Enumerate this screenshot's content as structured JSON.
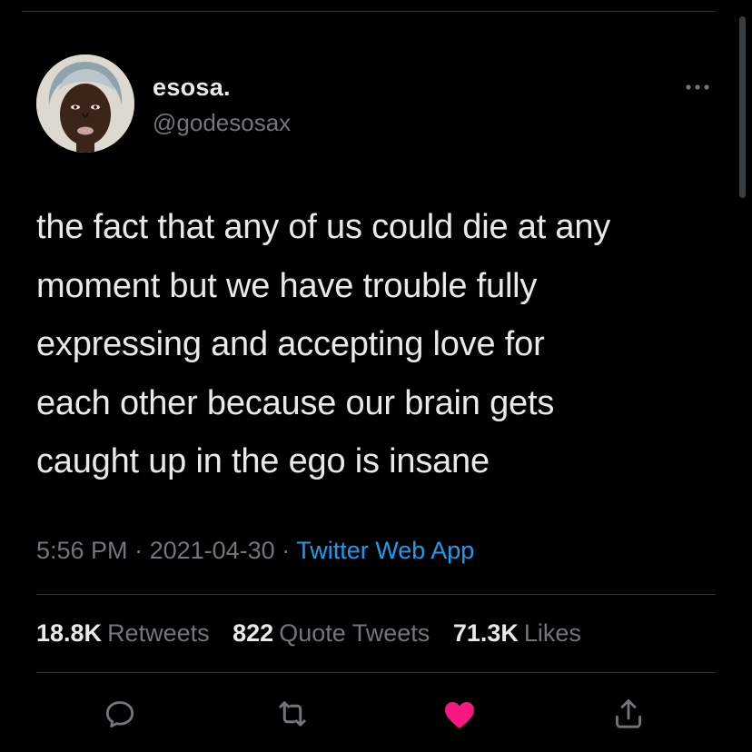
{
  "author": {
    "display_name": "esosa.",
    "handle": "@godesosax",
    "avatar_icon": "profile-photo"
  },
  "menu_icon": "more-dots-icon",
  "tweet": {
    "lines": [
      "the fact that any of us could die at any",
      "moment but we have trouble fully",
      "expressing and accepting love for",
      "each other because our brain gets",
      "caught up in the ego is insane"
    ]
  },
  "meta": {
    "time": "5:56 PM",
    "separator": " · ",
    "date": "2021-04-30",
    "source": "Twitter Web App"
  },
  "stats": {
    "retweets_count": "18.8K",
    "retweets_label": "Retweets",
    "quotes_count": "822",
    "quotes_label": "Quote Tweets",
    "likes_count": "71.3K",
    "likes_label": "Likes"
  },
  "actions": [
    {
      "icon": "reply-icon"
    },
    {
      "icon": "retweet-icon"
    },
    {
      "icon": "like-icon",
      "active": true
    },
    {
      "icon": "share-icon"
    }
  ],
  "colors": {
    "background": "#000000",
    "primary_text": "#e7e9ea",
    "secondary_text": "#71767b",
    "link": "#1d9bf0",
    "like_active": "#f91880",
    "divider": "#2f3336"
  }
}
